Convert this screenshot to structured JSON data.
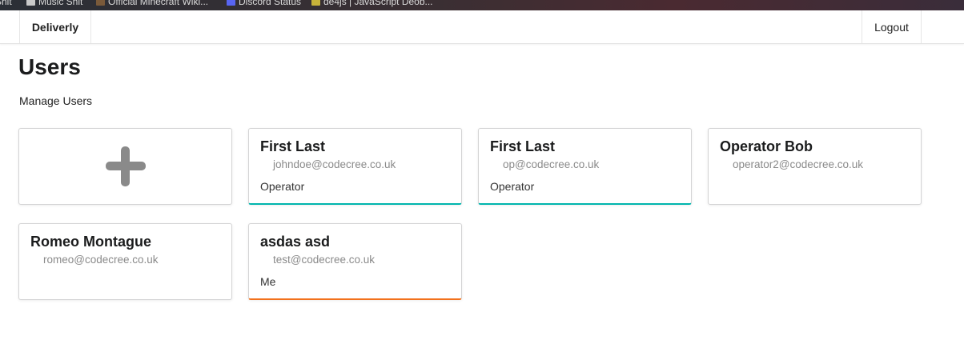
{
  "bookmarks": [
    {
      "label": "Shit",
      "icon": "folder-icon"
    },
    {
      "label": "Music Shit",
      "icon": "folder-icon"
    },
    {
      "label": "Official Minecraft Wiki...",
      "icon": "minecraft-icon"
    },
    {
      "label": "Discord Status",
      "icon": "discord-icon"
    },
    {
      "label": "de4js | JavaScript Deob...",
      "icon": "script-icon"
    }
  ],
  "navbar": {
    "brand": "Deliverly",
    "logout": "Logout"
  },
  "page": {
    "title": "Users",
    "subtitle": "Manage Users"
  },
  "add_card": {
    "icon": "plus-icon"
  },
  "users": [
    {
      "name": "First Last",
      "email": "johndoe@codecree.co.uk",
      "role": "Operator",
      "accent": "#00b5ad"
    },
    {
      "name": "First Last",
      "email": "op@codecree.co.uk",
      "role": "Operator",
      "accent": "#00b5ad"
    },
    {
      "name": "Operator Bob",
      "email": "operator2@codecree.co.uk",
      "role": "",
      "accent": ""
    },
    {
      "name": "Romeo Montague",
      "email": "romeo@codecree.co.uk",
      "role": "",
      "accent": ""
    },
    {
      "name": "asdas asd",
      "email": "test@codecree.co.uk",
      "role": "Me",
      "accent": "#f2711c"
    }
  ]
}
